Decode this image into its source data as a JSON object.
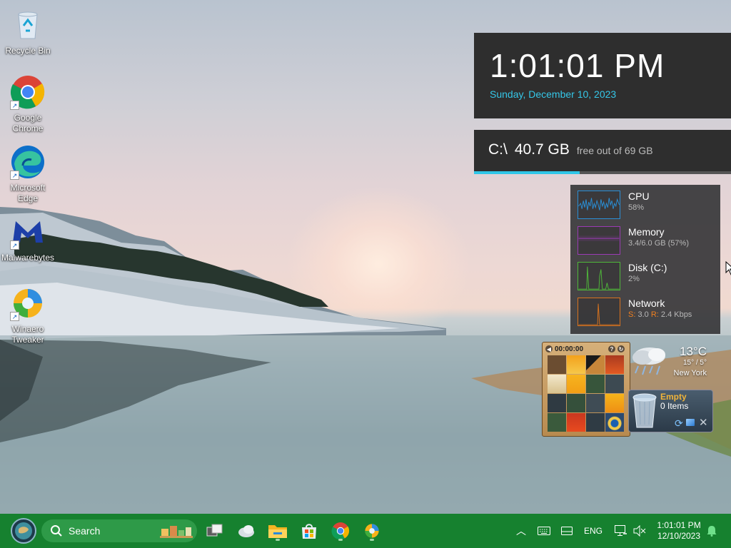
{
  "desktop_icons": [
    {
      "label": "Recycle Bin",
      "icon": "recycle-bin-icon"
    },
    {
      "label": "Google Chrome",
      "icon": "chrome-icon"
    },
    {
      "label": "Microsoft Edge",
      "icon": "edge-icon"
    },
    {
      "label": "Malwarebytes",
      "icon": "malwarebytes-icon"
    },
    {
      "label": "Winaero Tweaker",
      "icon": "winaero-tweaker-icon"
    }
  ],
  "clock_widget": {
    "time": "1:01:01 PM",
    "date": "Sunday, December 10, 2023",
    "accent_color": "#35c7e8"
  },
  "disk_widget": {
    "drive": "C:\\",
    "free": "40.7 GB",
    "rest": "free out of 69 GB",
    "used_fraction": 0.41
  },
  "perf_widget": {
    "cpu": {
      "name": "CPU",
      "value": "58%",
      "color": "#2a8fd6"
    },
    "memory": {
      "name": "Memory",
      "value": "3.4/6.0 GB (57%)",
      "color": "#9b3bb5"
    },
    "disk": {
      "name": "Disk (C:)",
      "value": "2%",
      "color": "#4fb83a"
    },
    "network": {
      "name": "Network",
      "s_label": "S:",
      "s_value": "3.0",
      "r_label": "R:",
      "r_value": "2.4 Kbps",
      "color": "#d9731e"
    }
  },
  "puzzle_gadget": {
    "timer": "00:00:00"
  },
  "weather_gadget": {
    "temp": "13°C",
    "range": "15° / 5°",
    "city": "New York"
  },
  "recycle_gadget": {
    "status": "Empty",
    "items": "0 Items"
  },
  "taskbar": {
    "search_label": "Search",
    "language": "ENG",
    "time": "1:01:01 PM",
    "date": "12/10/2023",
    "color": "#16812f"
  }
}
